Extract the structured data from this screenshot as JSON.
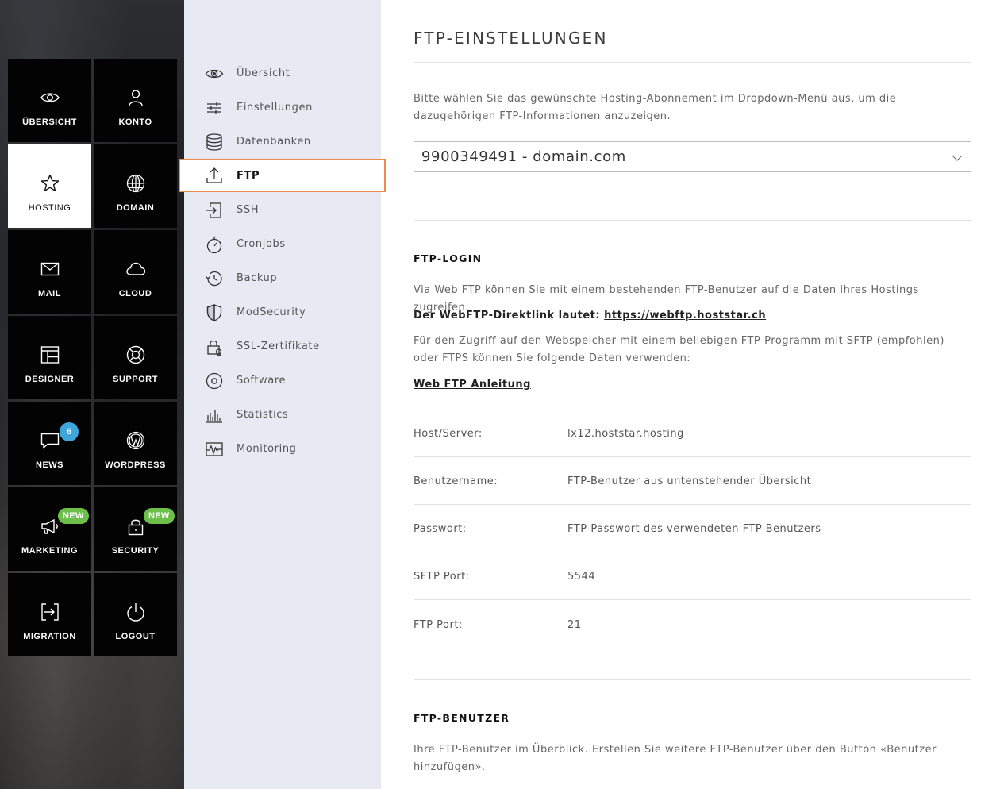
{
  "tiles": [
    {
      "label": "ÜBERSICHT",
      "icon": "eye-icon"
    },
    {
      "label": "KONTO",
      "icon": "user-icon"
    },
    {
      "label": "HOSTING",
      "icon": "star-icon",
      "active": true
    },
    {
      "label": "DOMAIN",
      "icon": "globe-icon"
    },
    {
      "label": "MAIL",
      "icon": "envelope-icon"
    },
    {
      "label": "CLOUD",
      "icon": "cloud-icon"
    },
    {
      "label": "DESIGNER",
      "icon": "layout-icon"
    },
    {
      "label": "SUPPORT",
      "icon": "lifebuoy-icon"
    },
    {
      "label": "NEWS",
      "icon": "chat-icon",
      "badge": "6"
    },
    {
      "label": "WORDPRESS",
      "icon": "wordpress-icon"
    },
    {
      "label": "MARKETING",
      "icon": "megaphone-icon",
      "badge": "NEW"
    },
    {
      "label": "SECURITY",
      "icon": "padlock-icon",
      "badge": "NEW"
    },
    {
      "label": "MIGRATION",
      "icon": "migration-icon"
    },
    {
      "label": "LOGOUT",
      "icon": "power-icon"
    }
  ],
  "submenu": [
    {
      "label": "Übersicht",
      "icon": "eye-icon"
    },
    {
      "label": "Einstellungen",
      "icon": "sliders-icon"
    },
    {
      "label": "Datenbanken",
      "icon": "database-icon"
    },
    {
      "label": "FTP",
      "icon": "upload-icon",
      "active": true
    },
    {
      "label": "SSH",
      "icon": "login-icon"
    },
    {
      "label": "Cronjobs",
      "icon": "stopwatch-icon"
    },
    {
      "label": "Backup",
      "icon": "history-icon"
    },
    {
      "label": "ModSecurity",
      "icon": "shield-icon"
    },
    {
      "label": "SSL-Zertifikate",
      "icon": "certificate-lock-icon"
    },
    {
      "label": "Software",
      "icon": "disc-icon"
    },
    {
      "label": "Statistics",
      "icon": "bar-chart-icon"
    },
    {
      "label": "Monitoring",
      "icon": "pulse-icon"
    }
  ],
  "main": {
    "title": "FTP-EINSTELLUNGEN",
    "intro": "Bitte wählen Sie das gewünschte Hosting-Abonnement im Dropdown-Menü aus, um die dazugehörigen FTP-Informationen anzuzeigen.",
    "select_value": "9900349491 - domain.com",
    "login": {
      "heading": "FTP-LOGIN",
      "p1": "Via Web FTP können Sie mit einem bestehenden FTP-Benutzer auf die Daten Ihres Hostings zugreifen.",
      "direct_label": "Der WebFTP-Direktlink lautet:",
      "direct_link": "https://webftp.hoststar.ch",
      "p2": "Für den Zugriff auf den Webspeicher mit einem beliebigen FTP-Programm mit SFTP (empfohlen) oder FTPS können Sie folgende Daten verwenden:",
      "guide_link": "Web FTP Anleitung"
    },
    "details": [
      {
        "key": "Host/Server:",
        "value": "lx12.hoststar.hosting"
      },
      {
        "key": "Benutzername:",
        "value": "FTP-Benutzer aus untenstehender Übersicht"
      },
      {
        "key": "Passwort:",
        "value": "FTP-Passwort des verwendeten FTP-Benutzers"
      },
      {
        "key": "SFTP Port:",
        "value": "5544"
      },
      {
        "key": "FTP Port:",
        "value": "21"
      }
    ],
    "users": {
      "heading": "FTP-BENUTZER",
      "p": "Ihre FTP-Benutzer im Überblick. Erstellen Sie weitere FTP-Benutzer über den Button «Benutzer hinzufügen»."
    }
  },
  "colors": {
    "accent": "#ed8b4b",
    "badge_blue": "#3fa6dc",
    "badge_green": "#6cc04a",
    "submenu_bg": "#e8eaf3"
  }
}
